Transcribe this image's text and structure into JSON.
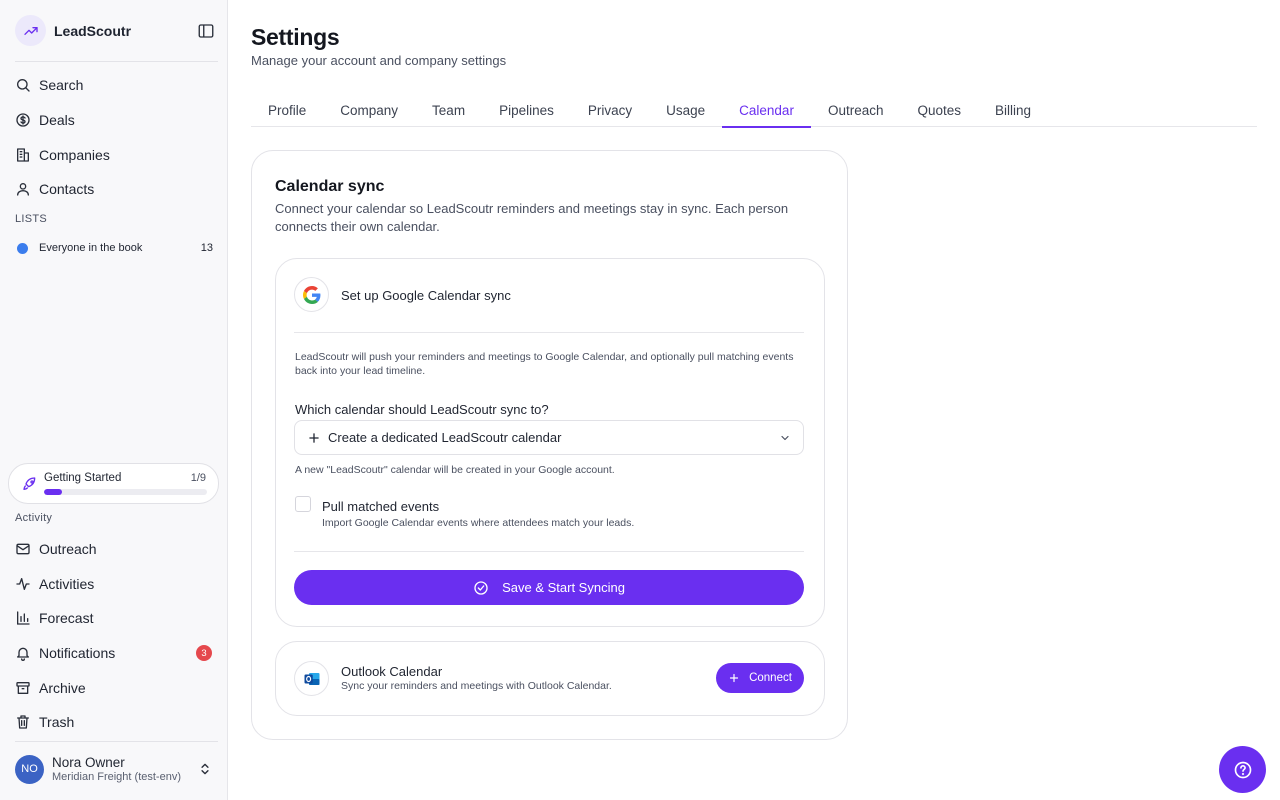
{
  "brand": {
    "name": "LeadScoutr"
  },
  "sidebar": {
    "nav": [
      {
        "label": "Search",
        "icon": "search-icon"
      },
      {
        "label": "Deals",
        "icon": "dollar-icon"
      },
      {
        "label": "Companies",
        "icon": "building-icon"
      },
      {
        "label": "Contacts",
        "icon": "user-icon"
      }
    ],
    "lists_label": "LISTS",
    "lists": [
      {
        "label": "Everyone in the book",
        "count": "13",
        "color": "#3b7ded"
      }
    ],
    "getting_started": {
      "title": "Getting Started",
      "count": "1/9",
      "progress": 0.111
    },
    "activity_label": "Activity",
    "activity": [
      {
        "label": "Outreach",
        "icon": "mail-icon"
      },
      {
        "label": "Activities",
        "icon": "activity-icon"
      },
      {
        "label": "Forecast",
        "icon": "bar-chart-icon"
      },
      {
        "label": "Notifications",
        "icon": "bell-icon",
        "badge": "3"
      },
      {
        "label": "Archive",
        "icon": "archive-icon"
      },
      {
        "label": "Trash",
        "icon": "trash-icon"
      }
    ],
    "user": {
      "initials": "NO",
      "name": "Nora Owner",
      "org": "Meridian Freight (test-env)"
    }
  },
  "page": {
    "title": "Settings",
    "subtitle": "Manage your account and company settings"
  },
  "tabs": [
    "Profile",
    "Company",
    "Team",
    "Pipelines",
    "Privacy",
    "Usage",
    "Calendar",
    "Outreach",
    "Quotes",
    "Billing"
  ],
  "active_tab": "Calendar",
  "calendar": {
    "title": "Calendar sync",
    "description": "Connect your calendar so LeadScoutr reminders and meetings stay in sync. Each person connects their own calendar.",
    "google": {
      "title": "Set up Google Calendar sync",
      "description": "LeadScoutr will push your reminders and meetings to Google Calendar, and optionally pull matching events back into your lead timeline.",
      "question": "Which calendar should LeadScoutr sync to?",
      "selected_option": "Create a dedicated LeadScoutr calendar",
      "hint": "A new \"LeadScoutr\" calendar will be created in your Google account.",
      "pull_label": "Pull matched events",
      "pull_sub": "Import Google Calendar events where attendees match your leads.",
      "pull_checked": false,
      "save_label": "Save & Start Syncing"
    },
    "outlook": {
      "title": "Outlook Calendar",
      "subtitle": "Sync your reminders and meetings with Outlook Calendar.",
      "connect_label": "Connect"
    }
  },
  "colors": {
    "accent": "#6a2ff0",
    "badge": "#e5484d",
    "list_dot": "#3b7ded",
    "avatar": "#3b63c4"
  }
}
